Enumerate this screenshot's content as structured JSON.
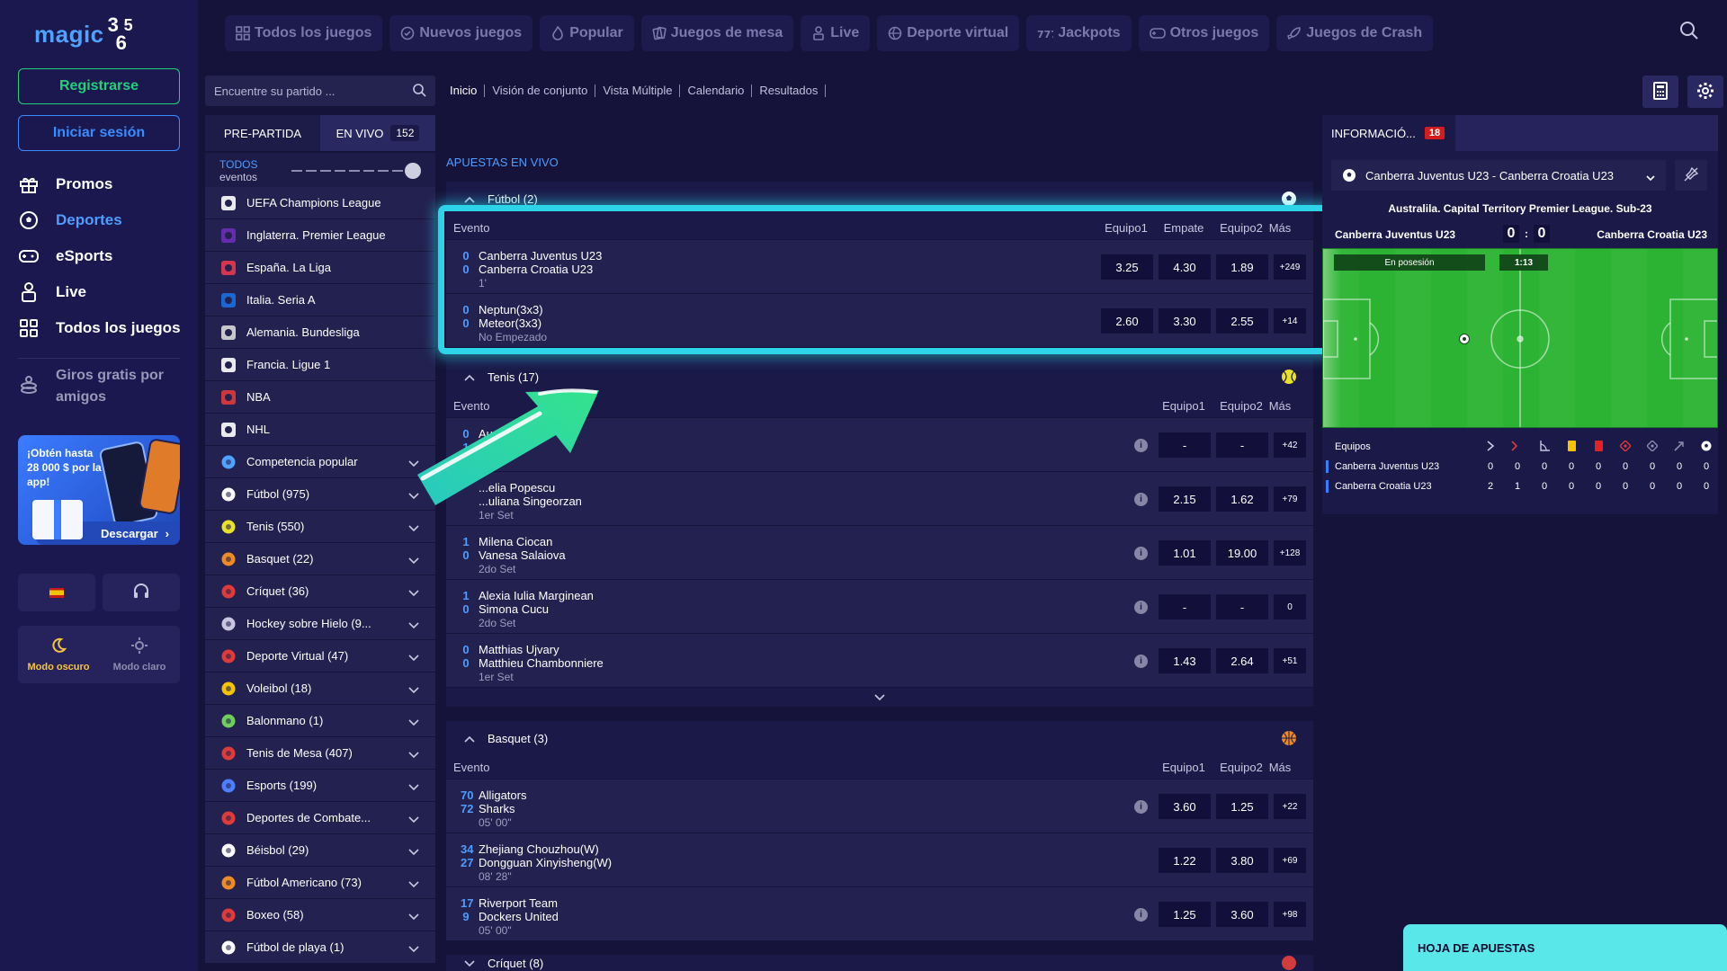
{
  "brand": {
    "word": "magic",
    "digits": [
      "3",
      "6",
      "5"
    ]
  },
  "auth": {
    "register": "Registrarse",
    "login": "Iniciar sesión"
  },
  "leftnav": {
    "items": [
      {
        "label": "Promos",
        "icon": "gift-icon"
      },
      {
        "label": "Deportes",
        "icon": "soccer-ball-icon",
        "active": true
      },
      {
        "label": "eSports",
        "icon": "gamepad-icon"
      },
      {
        "label": "Live",
        "icon": "live-person-icon"
      },
      {
        "label": "Todos los juegos",
        "icon": "grid-icon"
      }
    ],
    "giros": "Giros gratis por amigos",
    "promo": {
      "text": "¡Obtén hasta 28 000 $ por la app!",
      "button": "Descargar"
    },
    "modes": {
      "dark": "Modo oscuro",
      "light": "Modo claro"
    }
  },
  "topnav": [
    {
      "label": "Todos los juegos",
      "icon": "grid-icon"
    },
    {
      "label": "Nuevos juegos",
      "icon": "new-icon"
    },
    {
      "label": "Popular",
      "icon": "fire-icon"
    },
    {
      "label": "Juegos de mesa",
      "icon": "cards-icon"
    },
    {
      "label": "Live",
      "icon": "live-person-icon"
    },
    {
      "label": "Deporte virtual",
      "icon": "ball-icon"
    },
    {
      "label": "Jackpots",
      "icon": "slot-777-icon"
    },
    {
      "label": "Otros juegos",
      "icon": "gamepad-icon"
    },
    {
      "label": "Juegos de Crash",
      "icon": "rocket-icon"
    }
  ],
  "sportsbar": {
    "search_placeholder": "Encuentre su partido ...",
    "tab_pre": "PRE-PARTIDA",
    "tab_live": "EN VIVO",
    "live_count": "152",
    "todos": "TODOS",
    "eventos": "eventos",
    "leagues": [
      "UEFA Champions League",
      "Inglaterra. Premier League",
      "España. La Liga",
      "Italia. Seria A",
      "Alemania. Bundesliga",
      "Francia. Ligue 1",
      "NBA",
      "NHL"
    ],
    "sports": [
      "Competencia popular",
      "Fútbol (975)",
      "Tenis (550)",
      "Basquet (22)",
      "Críquet (36)",
      "Hockey sobre Hielo (9...",
      "Deporte Virtual (47)",
      "Voleibol (18)",
      "Balonmano (1)",
      "Tenis de Mesa (407)",
      "Esports (199)",
      "Deportes de Combate...",
      "Béisbol (29)",
      "Fútbol Americano (73)",
      "Boxeo (58)",
      "Fútbol de playa (1)"
    ]
  },
  "breadcrumbs": [
    "Inicio",
    "Visión de conjunto",
    "Vista Múltiple",
    "Calendario",
    "Resultados"
  ],
  "live": {
    "title": "APUESTAS EN VIVO",
    "col_evento": "Evento",
    "col_e1": "Equipo1",
    "col_draw": "Empate",
    "col_e2": "Equipo2",
    "col_more": "Más",
    "futbol": {
      "label": "Fútbol",
      "count": "(2)",
      "rows": [
        {
          "s1": "0",
          "s2": "0",
          "t1": "Canberra Juventus U23",
          "t2": "Canberra Croatia U23",
          "status": "1'",
          "o1": "3.25",
          "ox": "4.30",
          "o2": "1.89",
          "more": "+249"
        },
        {
          "s1": "0",
          "s2": "0",
          "t1": "Neptun(3x3)",
          "t2": "Meteor(3x3)",
          "status": "No Empezado",
          "o1": "2.60",
          "ox": "3.30",
          "o2": "2.55",
          "more": "+14"
        }
      ]
    },
    "tenis": {
      "label": "Tenis",
      "count": "(17)",
      "rows": [
        {
          "s1": "0",
          "s2": "1",
          "t1": "Aur...",
          "t2": "",
          "status": "",
          "o1": "-",
          "o2": "-",
          "more": "+42"
        },
        {
          "s1": "",
          "s2": "",
          "t1": "...elia Popescu",
          "t2": "...uliana Singeorzan",
          "status": "1er Set",
          "o1": "2.15",
          "o2": "1.62",
          "more": "+79"
        },
        {
          "s1": "1",
          "s2": "0",
          "t1": "Milena Ciocan",
          "t2": "Vanesa Salaiova",
          "status": "2do Set",
          "o1": "1.01",
          "o2": "19.00",
          "more": "+128"
        },
        {
          "s1": "1",
          "s2": "0",
          "t1": "Alexia Iulia Marginean",
          "t2": "Simona Cucu",
          "status": "2do Set",
          "o1": "-",
          "o2": "-",
          "more": "0"
        },
        {
          "s1": "0",
          "s2": "0",
          "t1": "Matthias Ujvary",
          "t2": "Matthieu Chambonniere",
          "status": "1er Set",
          "o1": "1.43",
          "o2": "2.64",
          "more": "+51"
        }
      ]
    },
    "basquet": {
      "label": "Basquet",
      "count": "(3)",
      "rows": [
        {
          "s1": "70",
          "s2": "72",
          "t1": "Alligators",
          "t2": "Sharks",
          "status": "05' 00\"",
          "o1": "3.60",
          "o2": "1.25",
          "more": "+22"
        },
        {
          "s1": "34",
          "s2": "27",
          "t1": "Zhejiang Chouzhou(W)",
          "t2": "Dongguan Xinyisheng(W)",
          "status": "08' 28\"",
          "o1": "1.22",
          "o2": "3.80",
          "more": "+69"
        },
        {
          "s1": "17",
          "s2": "9",
          "t1": "Riverport Team",
          "t2": "Dockers United",
          "status": "05' 00\"",
          "o1": "1.25",
          "o2": "3.60",
          "more": "+98"
        }
      ]
    },
    "criquet": {
      "label": "Críquet",
      "count": "(8)"
    }
  },
  "info": {
    "tab": "INFORMACIÓ...",
    "badge": "18",
    "match": "Canberra Juventus U23 - Canberra Croatia U23",
    "league": "Australila. Capital Territory Premier League. Sub-23",
    "team1": "Canberra Juventus U23",
    "team2": "Canberra Croatia U23",
    "score1": "0",
    "score2": "0",
    "possession": "En posesión",
    "clock": "1:13",
    "equipos": "Equipos",
    "stats": [
      {
        "team": "Canberra Juventus U23",
        "values": [
          "0",
          "0",
          "0",
          "0",
          "0",
          "0",
          "0",
          "0",
          "0"
        ]
      },
      {
        "team": "Canberra Croatia U23",
        "values": [
          "2",
          "1",
          "0",
          "0",
          "0",
          "0",
          "0",
          "0",
          "0"
        ]
      }
    ]
  },
  "betslip": "HOJA DE APUESTAS",
  "colors": {
    "accent": "#4f9dff",
    "green": "#22d07a",
    "highlight": "#2dd3e6",
    "pitch": "#2cb334",
    "badge": "#d31c1c"
  }
}
